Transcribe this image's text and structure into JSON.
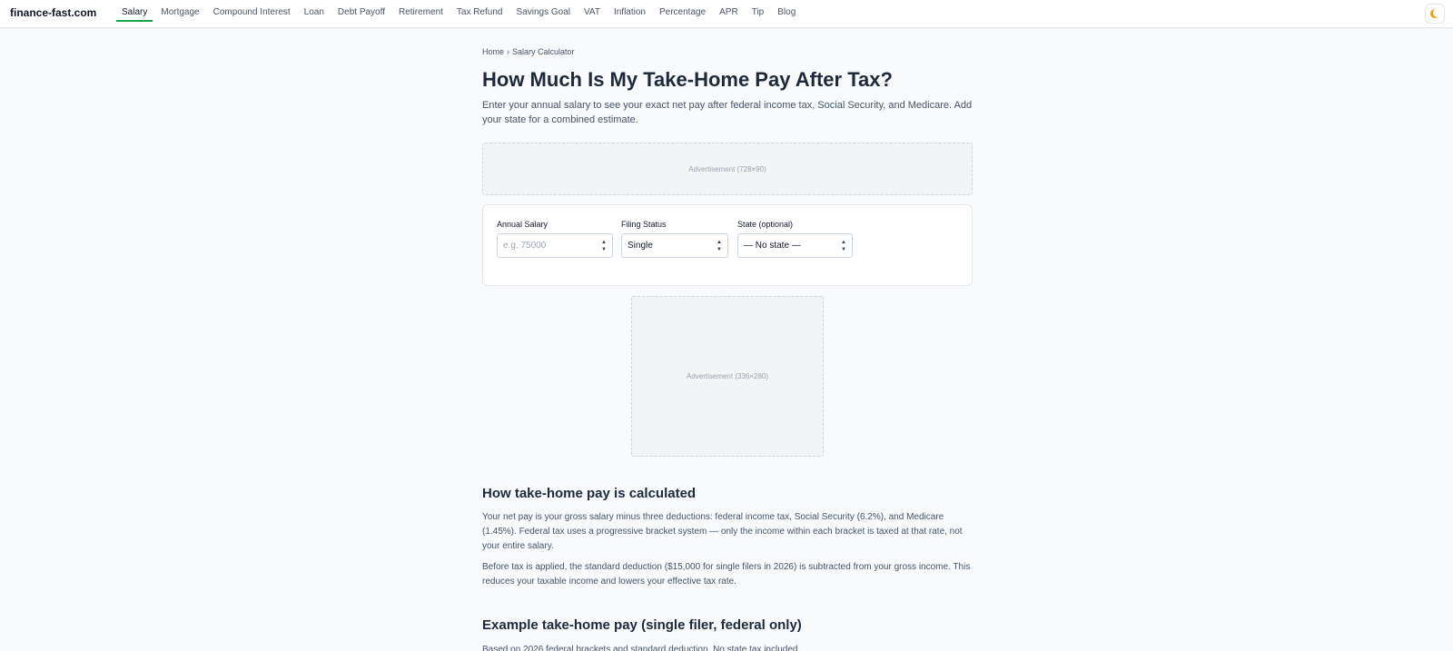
{
  "nav": {
    "brand": "finance-fast.com",
    "links": [
      {
        "label": "Salary",
        "active": true
      },
      {
        "label": "Mortgage"
      },
      {
        "label": "Compound Interest"
      },
      {
        "label": "Loan"
      },
      {
        "label": "Debt Payoff"
      },
      {
        "label": "Retirement"
      },
      {
        "label": "Tax Refund"
      },
      {
        "label": "Savings Goal"
      },
      {
        "label": "VAT"
      },
      {
        "label": "Inflation"
      },
      {
        "label": "Percentage"
      },
      {
        "label": "APR"
      },
      {
        "label": "Tip"
      },
      {
        "label": "Blog"
      }
    ],
    "theme_toggle_icon": "moon-icon"
  },
  "breadcrumb": {
    "home": "Home",
    "separator": "›",
    "current": "Salary Calculator"
  },
  "page": {
    "title": "How Much Is My Take-Home Pay After Tax?",
    "intro": "Enter your annual salary to see your exact net pay after federal income tax, Social Security, and Medicare. Add your state for a combined estimate."
  },
  "ads": {
    "banner": "Advertisement (728×90)",
    "box": "Advertisement (336×280)"
  },
  "form": {
    "salary": {
      "label": "Annual Salary",
      "placeholder": "e.g. 75000",
      "value": ""
    },
    "filing_status": {
      "label": "Filing Status",
      "value": "Single"
    },
    "state": {
      "label": "State (optional)",
      "value": "— No state —"
    }
  },
  "sections": {
    "calc": {
      "heading": "How take-home pay is calculated",
      "p1": "Your net pay is your gross salary minus three deductions: federal income tax, Social Security (6.2%), and Medicare (1.45%). Federal tax uses a progressive bracket system — only the income within each bracket is taxed at that rate, not your entire salary.",
      "p2": "Before tax is applied, the standard deduction ($15,000 for single filers in 2026) is subtracted from your gross income. This reduces your taxable income and lowers your effective tax rate."
    },
    "example": {
      "heading": "Example take-home pay (single filer, federal only)",
      "p1": "Based on 2026 federal brackets and standard deduction. No state tax included."
    }
  },
  "colors": {
    "accent": "#16a34a",
    "title": "#1e293b",
    "background": "#f8fafc"
  }
}
